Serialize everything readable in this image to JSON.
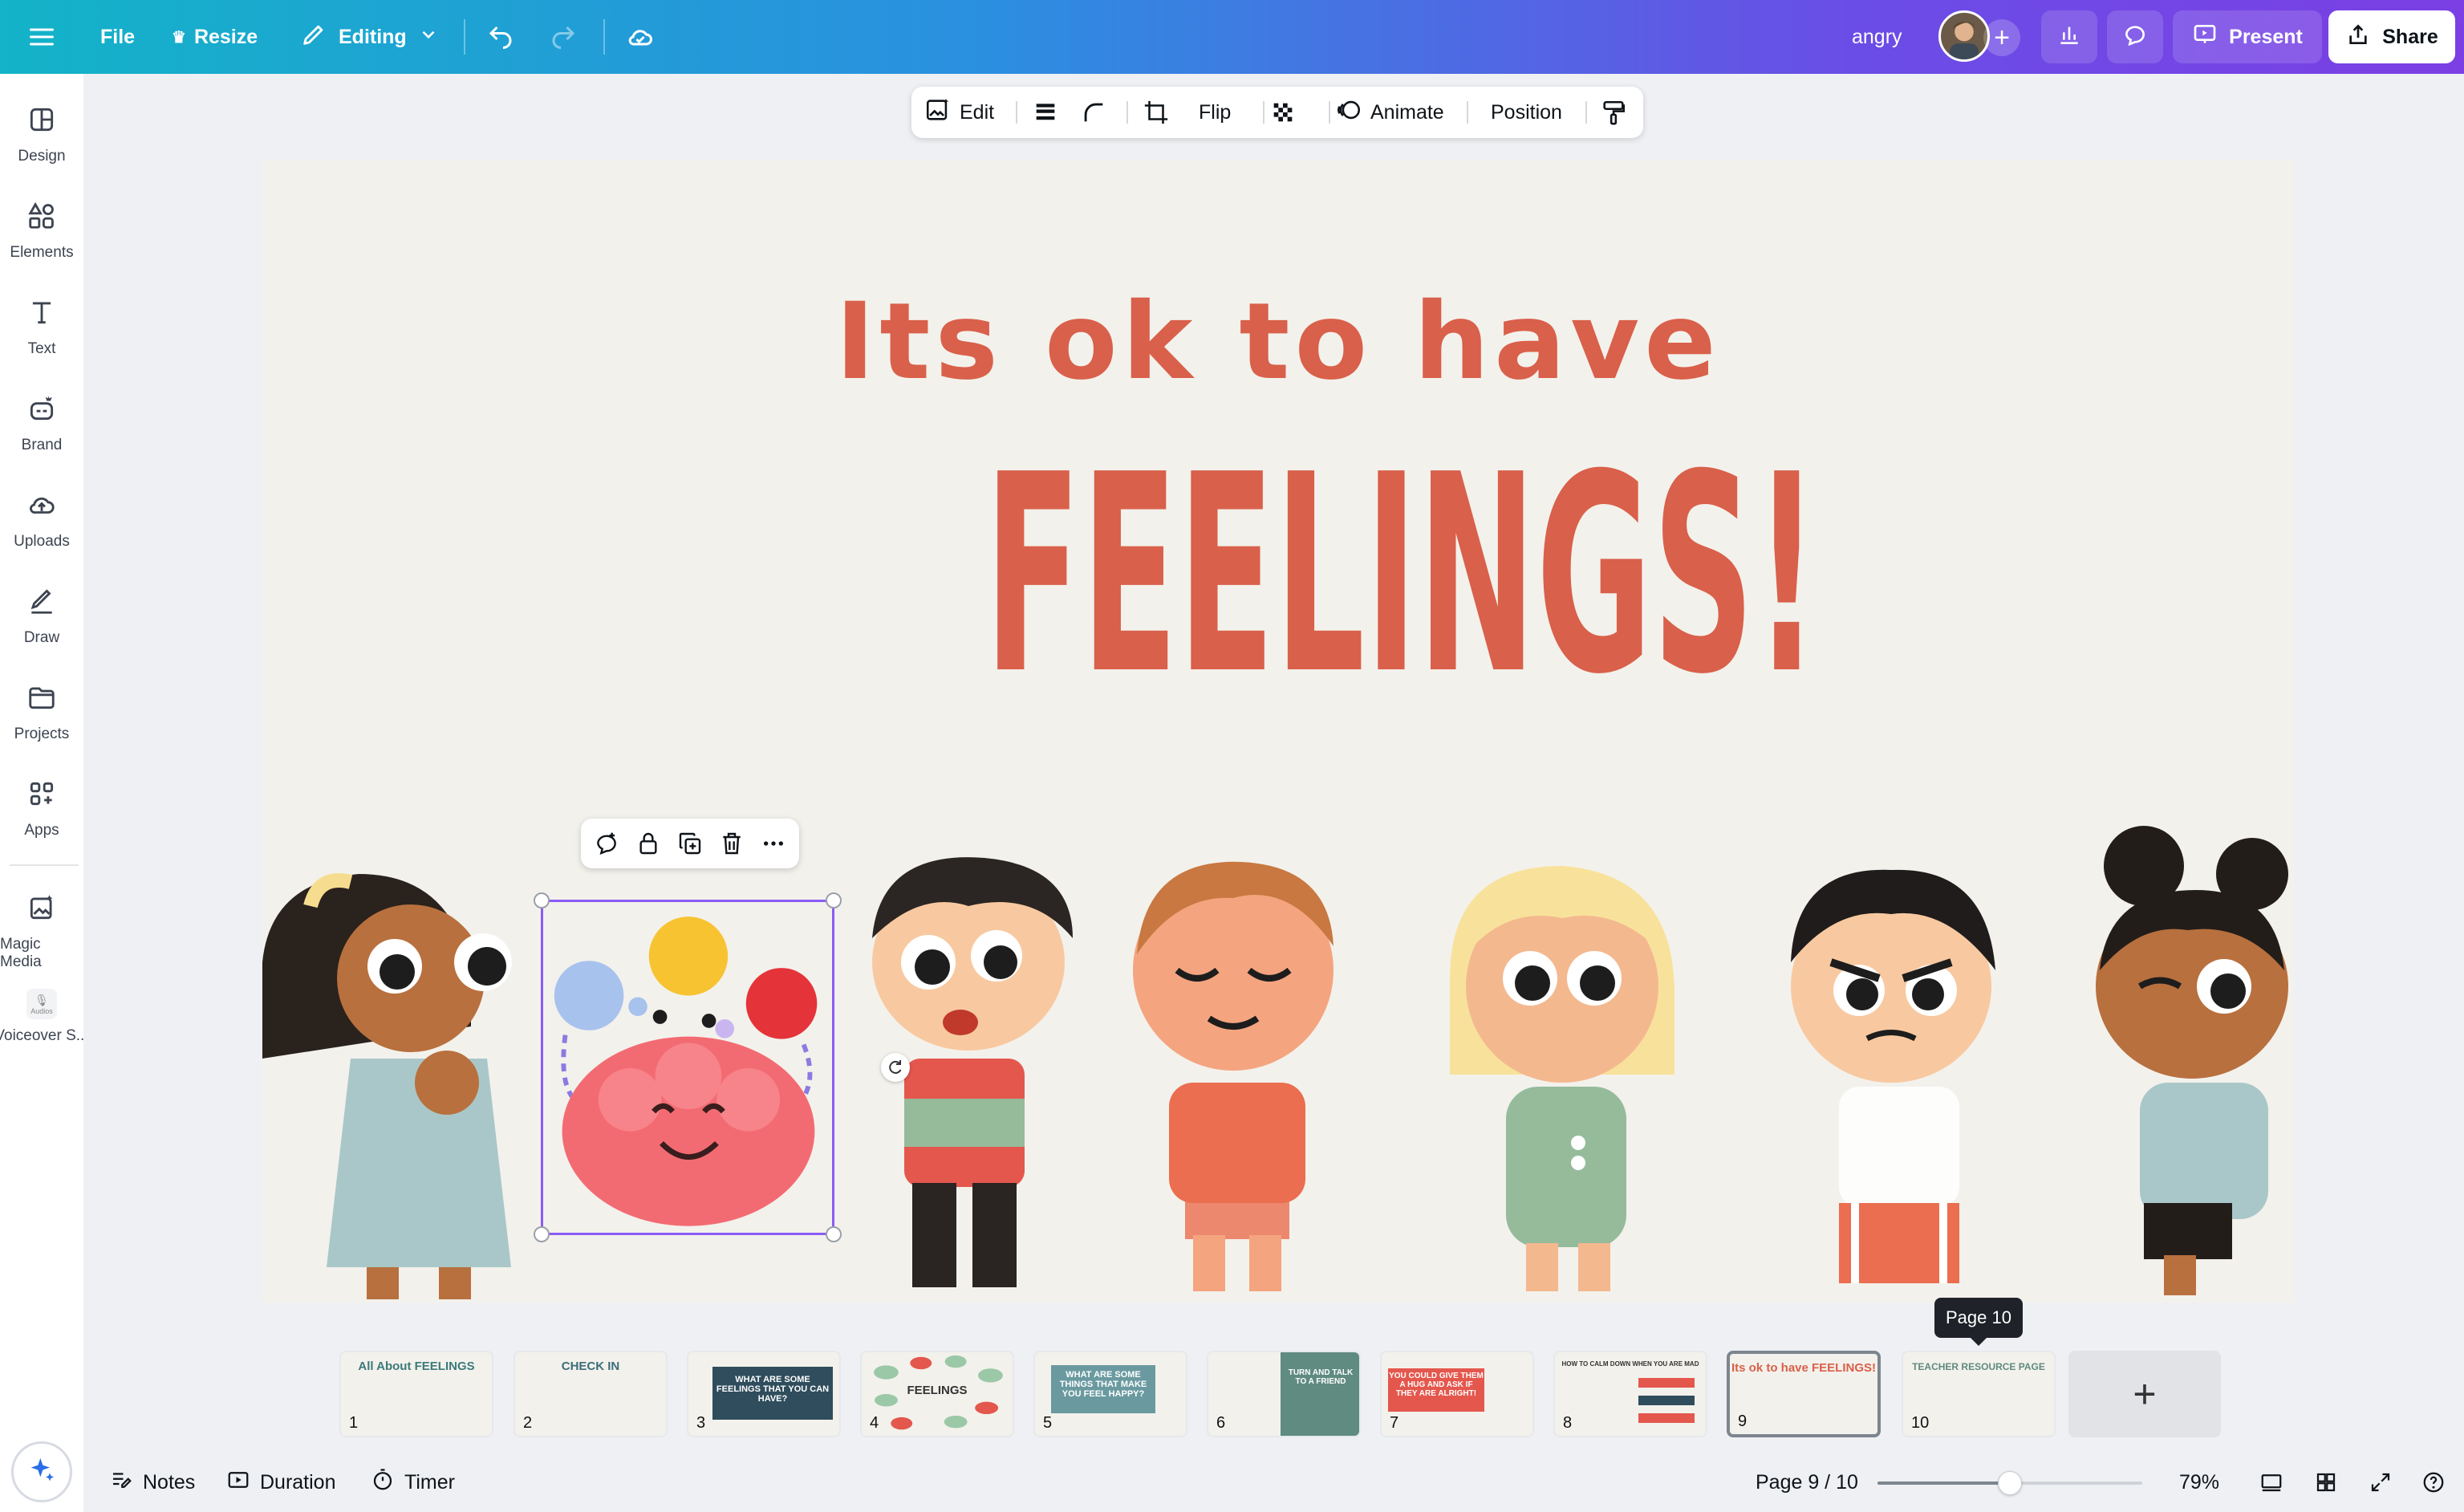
{
  "topbar": {
    "file_label": "File",
    "resize_label": "Resize",
    "editing_label": "Editing",
    "design_name": "angry",
    "present_label": "Present",
    "share_label": "Share"
  },
  "sidebar": {
    "items": [
      {
        "label": "Design",
        "icon": "layout-icon"
      },
      {
        "label": "Elements",
        "icon": "shapes-icon"
      },
      {
        "label": "Text",
        "icon": "text-icon"
      },
      {
        "label": "Brand",
        "icon": "brand-icon"
      },
      {
        "label": "Uploads",
        "icon": "cloud-upload-icon"
      },
      {
        "label": "Draw",
        "icon": "pen-icon"
      },
      {
        "label": "Projects",
        "icon": "folder-icon"
      },
      {
        "label": "Apps",
        "icon": "apps-icon"
      },
      {
        "label": "Magic Media",
        "icon": "magic-media-icon"
      },
      {
        "label": "Voiceover S...",
        "icon": "audio-icon"
      }
    ],
    "audio_badge": "Audios"
  },
  "context_toolbar": {
    "edit_label": "Edit",
    "flip_label": "Flip",
    "animate_label": "Animate",
    "position_label": "Position"
  },
  "slide": {
    "subtitle": "Its ok to have",
    "title": "FEELINGS!"
  },
  "pages": {
    "tooltip": "Page 10",
    "thumbs": [
      {
        "num": "1",
        "text": "All About FEELINGS"
      },
      {
        "num": "2",
        "text": "CHECK IN"
      },
      {
        "num": "3",
        "text": "WHAT ARE SOME FEELINGS THAT YOU CAN HAVE?"
      },
      {
        "num": "4",
        "text": "FEELINGS"
      },
      {
        "num": "5",
        "text": "WHAT ARE SOME THINGS THAT MAKE YOU FEEL HAPPY?"
      },
      {
        "num": "6",
        "text": "TURN AND TALK TO A FRIEND"
      },
      {
        "num": "7",
        "text": "YOU COULD GIVE THEM A HUG AND ASK IF THEY ARE ALRIGHT!"
      },
      {
        "num": "8",
        "text": "HOW TO CALM DOWN WHEN YOU ARE MAD"
      },
      {
        "num": "9",
        "text": "Its ok to have FEELINGS!"
      },
      {
        "num": "10",
        "text": "TEACHER RESOURCE PAGE"
      }
    ],
    "add_label": "+"
  },
  "bottombar": {
    "notes_label": "Notes",
    "duration_label": "Duration",
    "timer_label": "Timer",
    "page_indicator": "Page 9 / 10",
    "zoom_level": "79%",
    "zoom_fraction": 0.5
  },
  "colors": {
    "accent_title": "#d9604a",
    "selection": "#8b5cf6"
  }
}
